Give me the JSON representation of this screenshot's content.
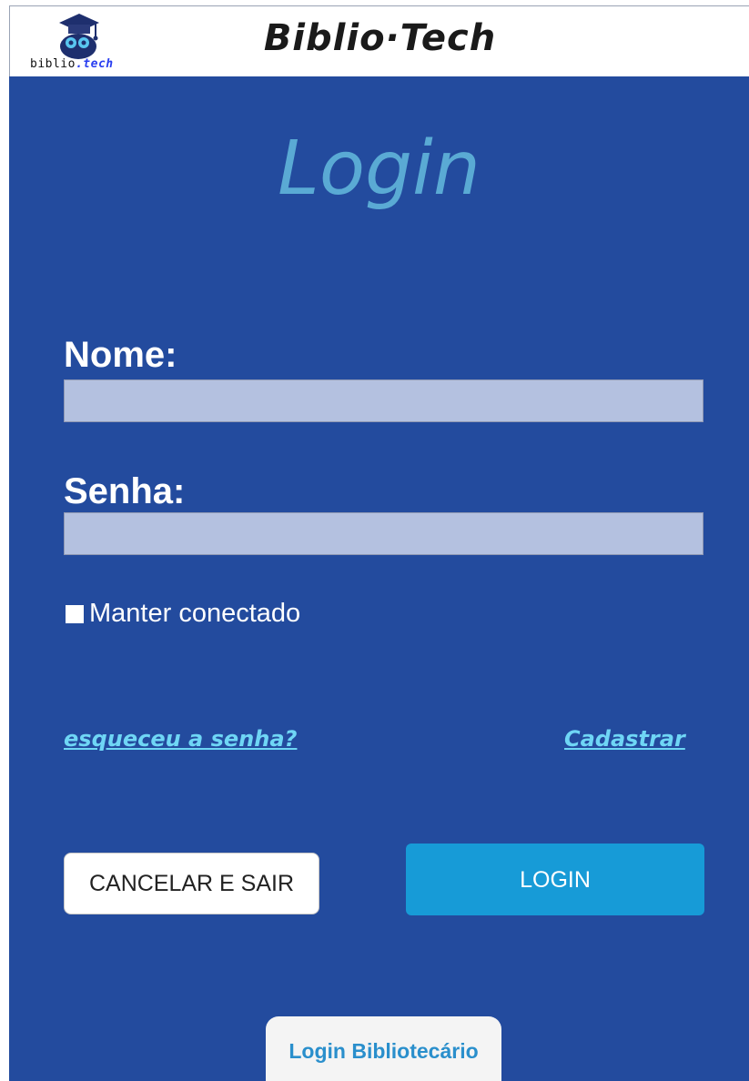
{
  "header": {
    "logo_text_dark": "biblio",
    "logo_text_accent": ".tech",
    "logo_icon": "graduation-cap-books-icon",
    "title": "Biblio·Tech"
  },
  "page": {
    "title": "Login"
  },
  "form": {
    "name_label": "Nome:",
    "name_value": "",
    "password_label": "Senha:",
    "password_value": "",
    "remember_label": "Manter conectado",
    "remember_checked": false
  },
  "links": {
    "forgot_password": "esqueceu a senha?",
    "register": "Cadastrar"
  },
  "buttons": {
    "cancel": "CANCELAR E SAIR",
    "login": "LOGIN",
    "librarian_login": "Login Bibliotecário"
  },
  "colors": {
    "background": "#234b9e",
    "title": "#5aaad4",
    "input": "#b4c1e0",
    "link": "#6fd6f5",
    "login_button": "#179bd7",
    "librarian_text": "#2a8fcc"
  }
}
